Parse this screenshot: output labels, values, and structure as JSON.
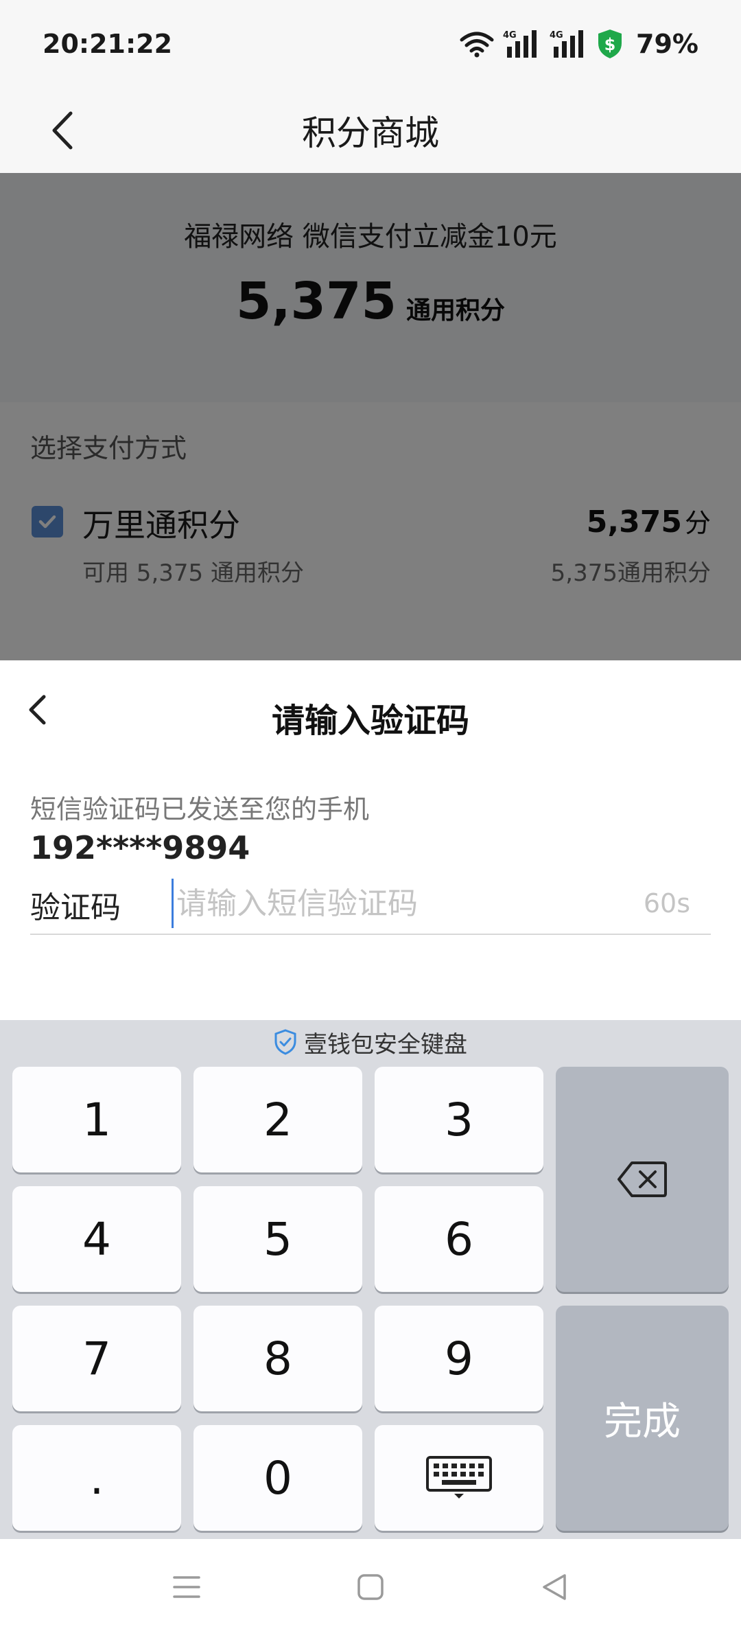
{
  "status_bar": {
    "time": "20:21:22",
    "battery": "79%",
    "icons": [
      "wifi-icon",
      "signal-4g-icon",
      "signal-4g-icon",
      "security-shield-icon"
    ]
  },
  "nav": {
    "title": "积分商城",
    "back_icon": "chevron-left-icon"
  },
  "product": {
    "name": "福禄网络 微信支付立减金10元",
    "price": "5,375",
    "price_unit": "通用积分"
  },
  "payment": {
    "heading": "选择支付方式",
    "method": {
      "name": "万里通积分",
      "available": "可用 5,375 通用积分",
      "amount": "5,375",
      "amount_unit": "分",
      "amount_sub": "5,375通用积分",
      "checked": true
    }
  },
  "sheet": {
    "title": "请输入验证码",
    "sms_hint": "短信验证码已发送至您的手机",
    "phone": "192****9894",
    "code_label": "验证码",
    "code_placeholder": "请输入短信验证码",
    "code_value": "",
    "countdown": "60s"
  },
  "keyboard": {
    "title": "壹钱包安全键盘",
    "keys": [
      "1",
      "2",
      "3",
      "4",
      "5",
      "6",
      "7",
      "8",
      "9",
      ".",
      "0"
    ],
    "done_label": "完成",
    "delete_icon": "backspace-icon",
    "hide_icon": "keyboard-hide-icon",
    "colors": {
      "panel": "#d9dbe0",
      "key": "#fcfcfe",
      "function_key": "#b2b7c0"
    }
  },
  "system_nav": {
    "icons": [
      "menu-icon",
      "home-icon",
      "back-icon"
    ]
  },
  "colors": {
    "accent": "#5b8fd6",
    "cursor": "#3b7ddd",
    "shield_green": "#1fa84a",
    "keyboard_shield": "#3b8ce0"
  }
}
